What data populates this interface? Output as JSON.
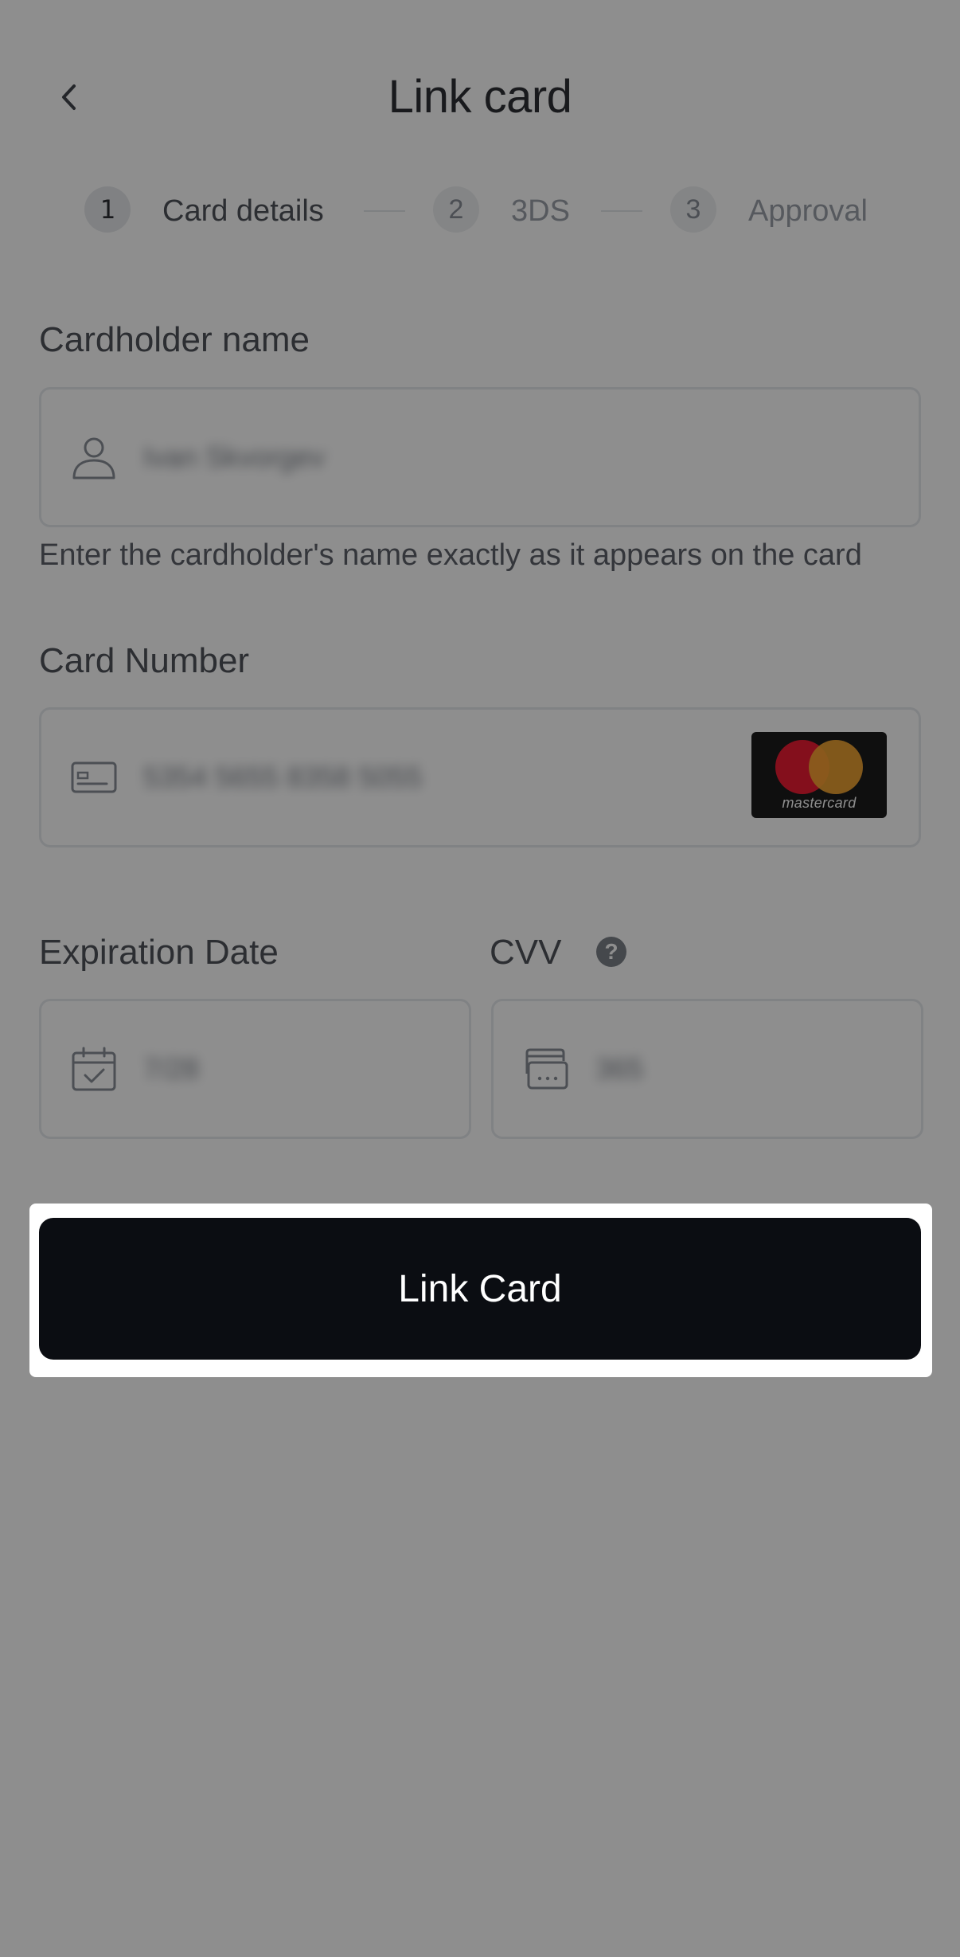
{
  "header": {
    "title": "Link card",
    "back_icon": "chevron-left-icon"
  },
  "stepper": {
    "steps": [
      {
        "number": "1",
        "label": "Card details",
        "active": true
      },
      {
        "number": "2",
        "label": "3DS",
        "active": false
      },
      {
        "number": "3",
        "label": "Approval",
        "active": false
      }
    ]
  },
  "form": {
    "cardholder": {
      "label": "Cardholder name",
      "icon": "user-icon",
      "value": "Ivan Skvorgev",
      "helper": "Enter the cardholder's name exactly as it appears on the card"
    },
    "card_number": {
      "label": "Card Number",
      "icon": "card-icon",
      "value": "5354 5655 8358 5055",
      "brand": "mastercard"
    },
    "expiration": {
      "label": "Expiration Date",
      "icon": "calendar-check-icon",
      "value": "7/28"
    },
    "cvv": {
      "label": "CVV",
      "icon": "card-cvv-icon",
      "help_icon": "question-circle-icon",
      "help_glyph": "?",
      "value": "365"
    }
  },
  "actions": {
    "submit_label": "Link Card"
  },
  "colors": {
    "primary_button": "#0b0d12",
    "overlay": "rgba(30,30,30,0.5)",
    "mastercard_red": "#eb001b",
    "mastercard_orange": "#f79e1b"
  }
}
